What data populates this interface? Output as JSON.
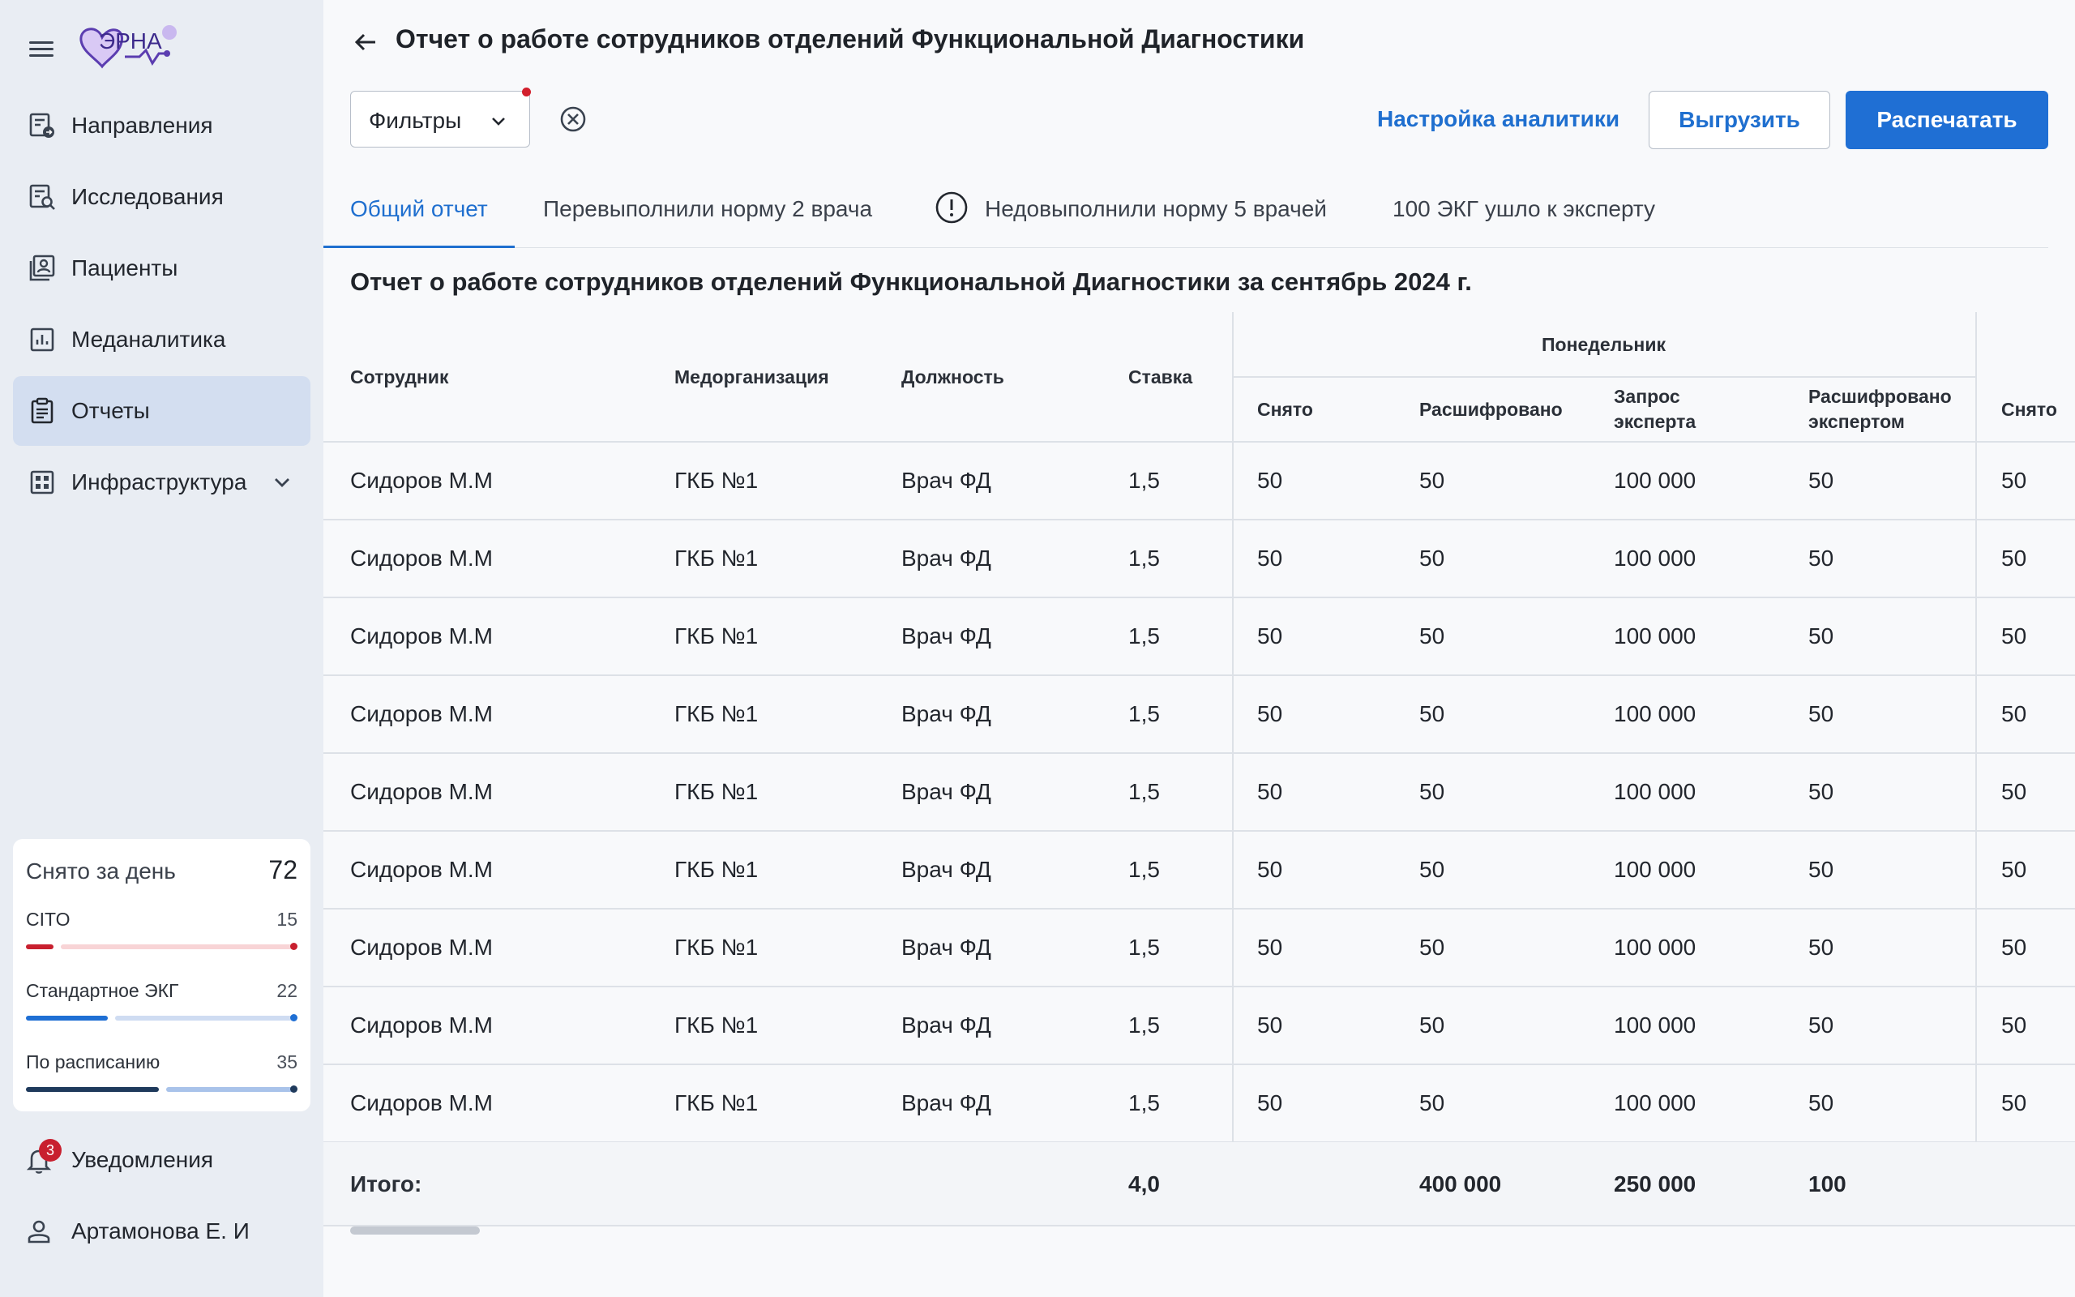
{
  "sidebar": {
    "logo_text": "ЭРНА",
    "nav": [
      {
        "label": "Направления",
        "icon": "referrals-icon",
        "active": false
      },
      {
        "label": "Исследования",
        "icon": "studies-icon",
        "active": false
      },
      {
        "label": "Пациенты",
        "icon": "patients-icon",
        "active": false
      },
      {
        "label": "Меданалитика",
        "icon": "analytics-icon",
        "active": false
      },
      {
        "label": "Отчеты",
        "icon": "reports-icon",
        "active": true
      },
      {
        "label": "Инфраструктура",
        "icon": "infrastructure-icon",
        "active": false
      }
    ],
    "stats": {
      "title": "Снято за день",
      "total": "72",
      "rows": [
        {
          "name": "CITO",
          "value": "15",
          "color": "#c8202f",
          "track_color": "#f8d4d6",
          "fill": 0.1
        },
        {
          "name": "Стандартное ЭКГ",
          "value": "22",
          "color": "#1f6fd4",
          "track_color": "#cfdcf2",
          "fill": 0.3
        },
        {
          "name": "По расписанию",
          "value": "35",
          "color": "#1f3a5c",
          "track_color": "#a9c3ea",
          "fill": 0.49
        }
      ]
    },
    "notifications": {
      "label": "Уведомления",
      "count": "3"
    },
    "user": {
      "name": "Артамонова Е. И"
    }
  },
  "header": {
    "title": "Отчет о работе сотрудников отделений Функциональной Диагностики"
  },
  "toolbar": {
    "filters_label": "Фильтры",
    "analytics_settings_label": "Настройка аналитики",
    "export_label": "Выгрузить",
    "print_label": "Распечатать"
  },
  "tabs": [
    {
      "label": "Общий отчет",
      "active": true
    },
    {
      "label": "Перевыполнили норму 2 врача",
      "active": false
    },
    {
      "label": "Недовыполнили норму 5 врачей",
      "active": false,
      "icon": "warning-icon"
    },
    {
      "label": "100 ЭКГ ушло к эксперту",
      "active": false
    }
  ],
  "report": {
    "title": "Отчет о работе сотрудников отделений Функциональной Диагностики за сентябрь 2024 г."
  },
  "table": {
    "columns": {
      "employee": "Сотрудник",
      "org": "Медорганизация",
      "position": "Должность",
      "rate": "Ставка"
    },
    "group_label": "Понедельник",
    "sub_columns": [
      "Снято",
      "Расшифровано",
      "Запрос эксперта",
      "Расшифровано экспертом"
    ],
    "next_group_first_col": "Снято",
    "rows": [
      {
        "employee": "Сидоров М.М",
        "org": "ГКБ №1",
        "position": "Врач ФД",
        "rate": "1,5",
        "taken": "50",
        "decoded": "50",
        "expert_request": "100 000",
        "expert_decoded": "50",
        "next_taken": "50"
      },
      {
        "employee": "Сидоров М.М",
        "org": "ГКБ №1",
        "position": "Врач ФД",
        "rate": "1,5",
        "taken": "50",
        "decoded": "50",
        "expert_request": "100 000",
        "expert_decoded": "50",
        "next_taken": "50"
      },
      {
        "employee": "Сидоров М.М",
        "org": "ГКБ №1",
        "position": "Врач ФД",
        "rate": "1,5",
        "taken": "50",
        "decoded": "50",
        "expert_request": "100 000",
        "expert_decoded": "50",
        "next_taken": "50"
      },
      {
        "employee": "Сидоров М.М",
        "org": "ГКБ №1",
        "position": "Врач ФД",
        "rate": "1,5",
        "taken": "50",
        "decoded": "50",
        "expert_request": "100 000",
        "expert_decoded": "50",
        "next_taken": "50"
      },
      {
        "employee": "Сидоров М.М",
        "org": "ГКБ №1",
        "position": "Врач ФД",
        "rate": "1,5",
        "taken": "50",
        "decoded": "50",
        "expert_request": "100 000",
        "expert_decoded": "50",
        "next_taken": "50"
      },
      {
        "employee": "Сидоров М.М",
        "org": "ГКБ №1",
        "position": "Врач ФД",
        "rate": "1,5",
        "taken": "50",
        "decoded": "50",
        "expert_request": "100 000",
        "expert_decoded": "50",
        "next_taken": "50"
      },
      {
        "employee": "Сидоров М.М",
        "org": "ГКБ №1",
        "position": "Врач ФД",
        "rate": "1,5",
        "taken": "50",
        "decoded": "50",
        "expert_request": "100 000",
        "expert_decoded": "50",
        "next_taken": "50"
      },
      {
        "employee": "Сидоров М.М",
        "org": "ГКБ №1",
        "position": "Врач ФД",
        "rate": "1,5",
        "taken": "50",
        "decoded": "50",
        "expert_request": "100 000",
        "expert_decoded": "50",
        "next_taken": "50"
      },
      {
        "employee": "Сидоров М.М",
        "org": "ГКБ №1",
        "position": "Врач ФД",
        "rate": "1,5",
        "taken": "50",
        "decoded": "50",
        "expert_request": "100 000",
        "expert_decoded": "50",
        "next_taken": "50"
      }
    ],
    "totals": {
      "label": "Итого:",
      "rate": "4,0",
      "decoded": "400 000",
      "expert_request": "250 000",
      "expert_decoded": "100"
    }
  }
}
